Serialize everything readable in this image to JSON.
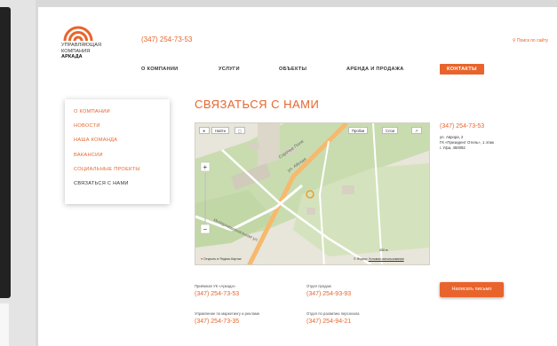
{
  "header": {
    "logo_line1": "УПРАВЛЯЮЩАЯ",
    "logo_line2": "КОМПАНИЯ",
    "logo_line3": "АРКАДА",
    "phone": "(347) 254-73-53",
    "search_label": "Поиск по сайту"
  },
  "nav": {
    "items": [
      {
        "label": "О КОМПАНИИ"
      },
      {
        "label": "УСЛУГИ"
      },
      {
        "label": "ОБЪЕКТЫ"
      },
      {
        "label": "АРЕНДА И ПРОДАЖА"
      },
      {
        "label": "КОНТАКТЫ",
        "active": true
      }
    ]
  },
  "sidebar": {
    "items": [
      {
        "label": "О КОМПАНИИ"
      },
      {
        "label": "НОВОСТИ"
      },
      {
        "label": "НАША КОМАНДА"
      },
      {
        "label": "ВАКАНСИИ"
      },
      {
        "label": "СОЦИАЛЬНЫЕ ПРОЕКТЫ"
      },
      {
        "label": "СВЯЗАТЬСЯ С НАМИ",
        "current": true
      }
    ]
  },
  "main": {
    "title": "СВЯЗАТЬСЯ С НАМИ"
  },
  "map": {
    "find_label": "Найти",
    "traffic_label": "Пробки",
    "layers_label": "Слои",
    "open_yandex": "Открыть в Яндекс.Картах",
    "scale": "400 м",
    "copyright": "© Яндекс",
    "terms": "Условия использования"
  },
  "info": {
    "phone": "(347) 254-73-53",
    "address_line1": "ул. Аврора, 2",
    "address_line2": "ГК «Президент Отель», 1 этаж",
    "address_line3": "г. Уфа, 450092"
  },
  "contacts": {
    "reception_label": "Приёмная УК «Аркада»",
    "reception_phone": "(347) 254-73-53",
    "sales_label": "Отдел продаж",
    "sales_phone": "(347) 254-93-93",
    "marketing_label": "Управление по маркетингу и рекламе",
    "marketing_phone": "(347) 254-73-35",
    "hr_label": "Отдел по развитию персонала",
    "hr_phone": "(347) 254-94-21"
  },
  "write_button": "Написать письмо",
  "colors": {
    "accent": "#e8642c",
    "text": "#333333",
    "map_green": "#c9dcb0",
    "map_road": "#f6b96d"
  }
}
